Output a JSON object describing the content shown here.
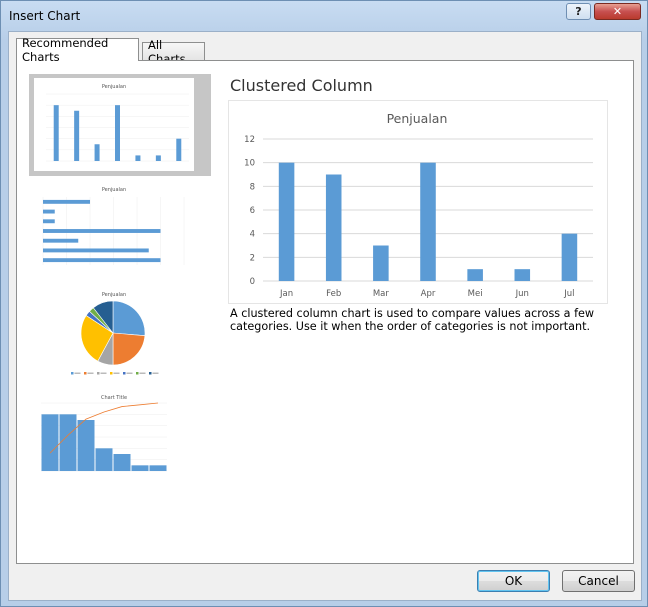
{
  "window": {
    "title": "Insert Chart",
    "help_label": "?",
    "close_label": "✕"
  },
  "tabs": [
    {
      "label": "Recommended Charts",
      "active": true
    },
    {
      "label": "All Charts",
      "active": false
    }
  ],
  "thumbnails": [
    {
      "name": "clustered-column",
      "title": "Penjualan"
    },
    {
      "name": "clustered-bar",
      "title": "Penjualan"
    },
    {
      "name": "pie",
      "title": "Penjualan"
    },
    {
      "name": "pareto",
      "title": "Chart Title"
    }
  ],
  "preview": {
    "chart_type_name": "Clustered Column",
    "description": "A clustered column chart is used to compare values across a few categories. Use it when the order of categories is not important."
  },
  "chart_data": {
    "type": "bar",
    "title": "Penjualan",
    "categories": [
      "Jan",
      "Feb",
      "Mar",
      "Apr",
      "Mei",
      "Jun",
      "Jul"
    ],
    "values": [
      10,
      9,
      3,
      10,
      1,
      1,
      4
    ],
    "ylim": [
      0,
      12
    ],
    "yticks": [
      0,
      2,
      4,
      6,
      8,
      10,
      12
    ],
    "xlabel": "",
    "ylabel": "",
    "grid": true,
    "bar_color": "#5b9bd5"
  },
  "buttons": {
    "ok": "OK",
    "cancel": "Cancel"
  },
  "colors": {
    "accent": "#5b9bd5",
    "pie": [
      "#5b9bd5",
      "#ed7d31",
      "#a5a5a5",
      "#ffc000",
      "#4472c4",
      "#70ad47",
      "#255e91"
    ],
    "pareto_line": "#ed7d31"
  }
}
